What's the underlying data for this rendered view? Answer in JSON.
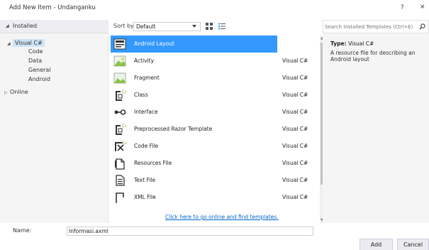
{
  "window": {
    "title": "Add New Item - Undanganku",
    "help": "?",
    "close": "×"
  },
  "tree": {
    "installed": "Installed",
    "visual_csharp": "Visual C#",
    "children": [
      "Code",
      "Data",
      "General",
      "Android"
    ],
    "online": "Online"
  },
  "sort": {
    "label": "Sort by:",
    "value": "Default"
  },
  "templates": [
    {
      "name": "Android Layout",
      "lang": "Visual C#",
      "icon": "android-layout-icon"
    },
    {
      "name": "Activity",
      "lang": "Visual C#",
      "icon": "activity-icon"
    },
    {
      "name": "Fragment",
      "lang": "Visual C#",
      "icon": "fragment-icon"
    },
    {
      "name": "Class",
      "lang": "Visual C#",
      "icon": "class-icon"
    },
    {
      "name": "Interface",
      "lang": "Visual C#",
      "icon": "interface-icon"
    },
    {
      "name": "Preprocessed Razor Template",
      "lang": "Visual C#",
      "icon": "razor-template-icon"
    },
    {
      "name": "Code File",
      "lang": "Visual C#",
      "icon": "code-file-icon"
    },
    {
      "name": "Resources File",
      "lang": "Visual C#",
      "icon": "resources-file-icon"
    },
    {
      "name": "Text File",
      "lang": "Visual C#",
      "icon": "text-file-icon"
    },
    {
      "name": "XML File",
      "lang": "Visual C#",
      "icon": "xml-file-icon"
    }
  ],
  "online_link": "Click here to go online and find templates.",
  "search": {
    "placeholder": "Search Installed Templates (Ctrl+E)"
  },
  "details": {
    "type_label": "Type:",
    "type_value": "Visual C#",
    "description": "A resource file for describing an Android layout"
  },
  "name_field": {
    "label": "Name:",
    "value": "Informasi.axml"
  },
  "buttons": {
    "add": "Add",
    "cancel": "Cancel"
  },
  "colors": {
    "selection": "#3399ff",
    "link": "#0066cc",
    "android_green": "#8bc34a"
  }
}
